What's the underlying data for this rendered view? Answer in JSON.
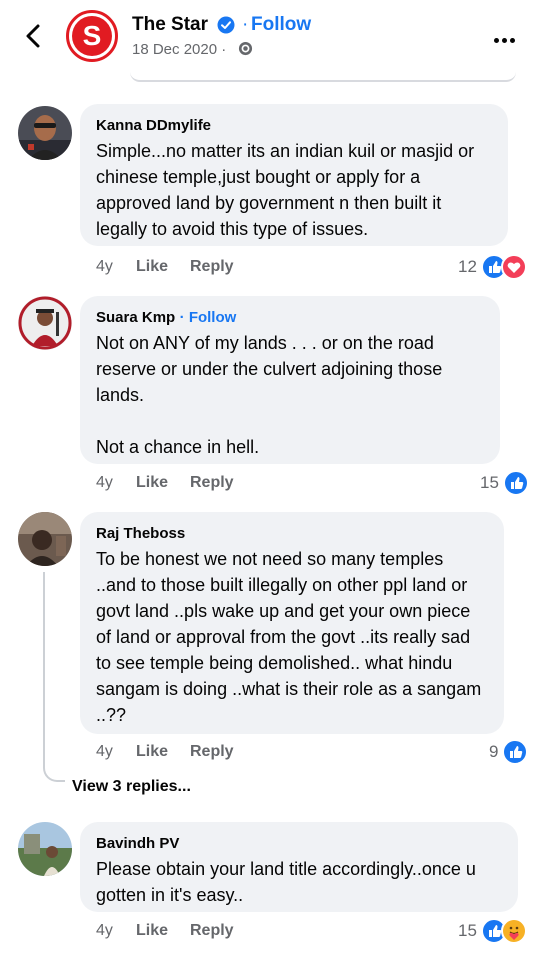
{
  "header": {
    "page_name": "The Star",
    "follow_label": "Follow",
    "date": "18 Dec 2020 ·",
    "logo_letter": "S",
    "brand_color": "#e11b22",
    "accent_color": "#1877f2"
  },
  "comments": [
    {
      "name": "Kanna DDmylife",
      "follow": "",
      "text": "Simple...no matter its an indian kuil or masjid or chinese temple,just bought or apply for a approved land by government n then built it legally to avoid this type of issues.",
      "age": "4y",
      "like": "Like",
      "reply": "Reply",
      "reaction_count": "12",
      "reactions": [
        "like-icon",
        "love-icon"
      ]
    },
    {
      "name": "Suara Kmp",
      "follow": "· Follow",
      "text": "Not on ANY of my lands . . . or on the road reserve or under the culvert adjoining those lands.\n\nNot a chance in hell.",
      "age": "4y",
      "like": "Like",
      "reply": "Reply",
      "reaction_count": "15",
      "reactions": [
        "like-icon"
      ]
    },
    {
      "name": "Raj Theboss",
      "follow": "",
      "text": "To be honest we not need so many temples ..and to those built illegally on other ppl land or govt land ..pls wake up and get your own piece of land or approval from the govt ..its really sad to see temple being demolished.. what hindu sangam is doing ..what is their role as a sangam ..??",
      "age": "4y",
      "like": "Like",
      "reply": "Reply",
      "reaction_count": "9",
      "reactions": [
        "like-icon"
      ]
    },
    {
      "name": "Bavindh PV",
      "follow": "",
      "text": "Please obtain your land title accordingly..once u gotten in it's easy..",
      "age": "4y",
      "like": "Like",
      "reply": "Reply",
      "reaction_count": "15",
      "reactions": [
        "like-icon",
        "care-icon"
      ]
    }
  ],
  "view_replies": "View 3 replies..."
}
